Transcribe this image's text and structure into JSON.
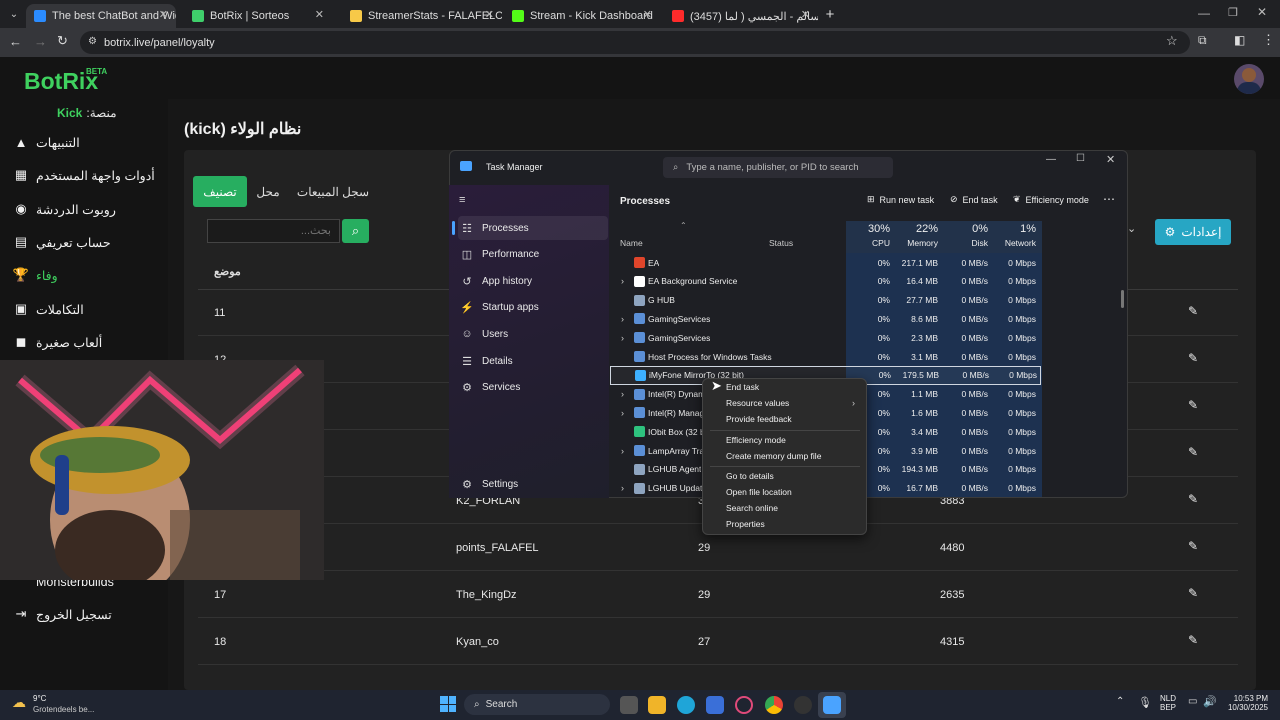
{
  "browser": {
    "tabs": [
      {
        "title": "The best ChatBot and Widgets",
        "color": "#2b8cff"
      },
      {
        "title": "BotRix | Sorteos",
        "color": "#3fcf6b"
      },
      {
        "title": "StreamerStats - FALAFELCO Pr...",
        "color": "#f7c948"
      },
      {
        "title": "Stream - Kick Dashboard",
        "color": "#53fc18"
      },
      {
        "title": "(3457) سليم سالم - الجمسي ( لما...",
        "color": "#ff2b2b"
      }
    ],
    "url": "botrix.live/panel/loyalty"
  },
  "app": {
    "logo": "BotRix",
    "logo_badge": "BETA",
    "platform_label": "منصة:",
    "platform_value": "Kick",
    "page_title": "نظام الولاء (kick)",
    "sidebar": [
      {
        "label": "التنبيهات",
        "icon": "warning-icon"
      },
      {
        "label": "أدوات واجهة المستخدم",
        "icon": "widgets-icon"
      },
      {
        "label": "روبوت الدردشة",
        "icon": "robot-icon"
      },
      {
        "label": "حساب تعريفي",
        "icon": "id-card-icon"
      },
      {
        "label": "وفاء",
        "icon": "trophy-icon"
      },
      {
        "label": "التكاملات",
        "icon": "integrations-icon"
      },
      {
        "label": "ألعاب صغيرة",
        "icon": "gamepad-icon"
      }
    ],
    "sidebar_bottom": [
      {
        "label": "Monsterbuilds"
      },
      {
        "label": "تسجيل الخروج",
        "icon": "logout-icon"
      }
    ],
    "tabs": [
      "تصنيف",
      "محل",
      "سجل المبيعات"
    ],
    "search_placeholder": "بحث...",
    "settings_button": "إعدادات",
    "table_header": "موضع",
    "rows": [
      {
        "pos": "11",
        "name": "",
        "a": "",
        "b": ""
      },
      {
        "pos": "12",
        "name": "",
        "a": "",
        "b": ""
      },
      {
        "pos": "",
        "name": "",
        "a": "",
        "b": ""
      },
      {
        "pos": "",
        "name": "",
        "a": "",
        "b": ""
      },
      {
        "pos": "",
        "name": "K2_FORLAN",
        "a": "3",
        "b": "3883"
      },
      {
        "pos": "",
        "name": "points_FALAFEL",
        "a": "29",
        "b": "4480"
      },
      {
        "pos": "17",
        "name": "The_KingDz",
        "a": "29",
        "b": "2635"
      },
      {
        "pos": "18",
        "name": "Kyan_co",
        "a": "27",
        "b": "4315"
      }
    ]
  },
  "taskmanager": {
    "title": "Task Manager",
    "search_placeholder": "Type a name, publisher, or PID to search",
    "nav": [
      "Processes",
      "Performance",
      "App history",
      "Startup apps",
      "Users",
      "Details",
      "Services"
    ],
    "nav_icons": [
      "processes-icon",
      "performance-icon",
      "app-history-icon",
      "startup-icon",
      "users-icon",
      "details-icon",
      "services-icon"
    ],
    "settings": "Settings",
    "section_title": "Processes",
    "actions": {
      "run_new_task": "Run new task",
      "end_task": "End task",
      "efficiency_mode": "Efficiency mode"
    },
    "columns": {
      "name": "Name",
      "status": "Status",
      "cpu_pct": "30%",
      "cpu": "CPU",
      "mem_pct": "22%",
      "mem": "Memory",
      "disk_pct": "0%",
      "disk": "Disk",
      "net_pct": "1%",
      "net": "Network"
    },
    "processes": [
      {
        "name": "EA",
        "expand": false,
        "cpu": "0%",
        "mem": "217.1 MB",
        "disk": "0 MB/s",
        "net": "0 Mbps",
        "color": "#e0452b"
      },
      {
        "name": "EA Background Service",
        "expand": true,
        "cpu": "0%",
        "mem": "16.4 MB",
        "disk": "0 MB/s",
        "net": "0 Mbps",
        "color": "#ffffff"
      },
      {
        "name": "G HUB",
        "expand": false,
        "cpu": "0%",
        "mem": "27.7 MB",
        "disk": "0 MB/s",
        "net": "0 Mbps",
        "color": "#8ea4c0"
      },
      {
        "name": "GamingServices",
        "expand": true,
        "cpu": "0%",
        "mem": "8.6 MB",
        "disk": "0 MB/s",
        "net": "0 Mbps",
        "color": "#5b8fd6"
      },
      {
        "name": "GamingServices",
        "expand": true,
        "cpu": "0%",
        "mem": "2.3 MB",
        "disk": "0 MB/s",
        "net": "0 Mbps",
        "color": "#5b8fd6"
      },
      {
        "name": "Host Process for Windows Tasks",
        "expand": false,
        "cpu": "0%",
        "mem": "3.1 MB",
        "disk": "0 MB/s",
        "net": "0 Mbps",
        "color": "#5b8fd6"
      },
      {
        "name": "iMyFone MirrorTo (32 bit)",
        "expand": false,
        "cpu": "0%",
        "mem": "179.5 MB",
        "disk": "0 MB/s",
        "net": "0 Mbps",
        "color": "#3db0ff"
      },
      {
        "name": "Intel(R) Dynam",
        "expand": true,
        "cpu": "0%",
        "mem": "1.1 MB",
        "disk": "0 MB/s",
        "net": "0 Mbps",
        "color": "#5b8fd6"
      },
      {
        "name": "Intel(R) Manag",
        "expand": true,
        "cpu": "0%",
        "mem": "1.6 MB",
        "disk": "0 MB/s",
        "net": "0 Mbps",
        "color": "#5b8fd6"
      },
      {
        "name": "IObit Box (32 bi",
        "expand": false,
        "cpu": "0%",
        "mem": "3.4 MB",
        "disk": "0 MB/s",
        "net": "0 Mbps",
        "color": "#2ec27e"
      },
      {
        "name": "LampArray Tra",
        "expand": true,
        "cpu": "0%",
        "mem": "3.9 MB",
        "disk": "0 MB/s",
        "net": "0 Mbps",
        "color": "#5b8fd6"
      },
      {
        "name": "LGHUB Agent",
        "expand": false,
        "cpu": "0%",
        "mem": "194.3 MB",
        "disk": "0 MB/s",
        "net": "0 Mbps",
        "color": "#8ea4c0"
      },
      {
        "name": "LGHUB Update",
        "expand": true,
        "cpu": "0%",
        "mem": "16.7 MB",
        "disk": "0 MB/s",
        "net": "0 Mbps",
        "color": "#8ea4c0"
      }
    ],
    "context_menu": [
      "End task",
      "Resource values",
      "Provide feedback",
      "Efficiency mode",
      "Create memory dump file",
      "Go to details",
      "Open file location",
      "Search online",
      "Properties"
    ]
  },
  "taskbar": {
    "weather_temp": "9°C",
    "weather_desc": "Grotendeels be...",
    "search": "Search",
    "lang_top": "NLD",
    "lang_bottom": "BEP",
    "time": "10:53 PM",
    "date": "10/30/2025"
  }
}
